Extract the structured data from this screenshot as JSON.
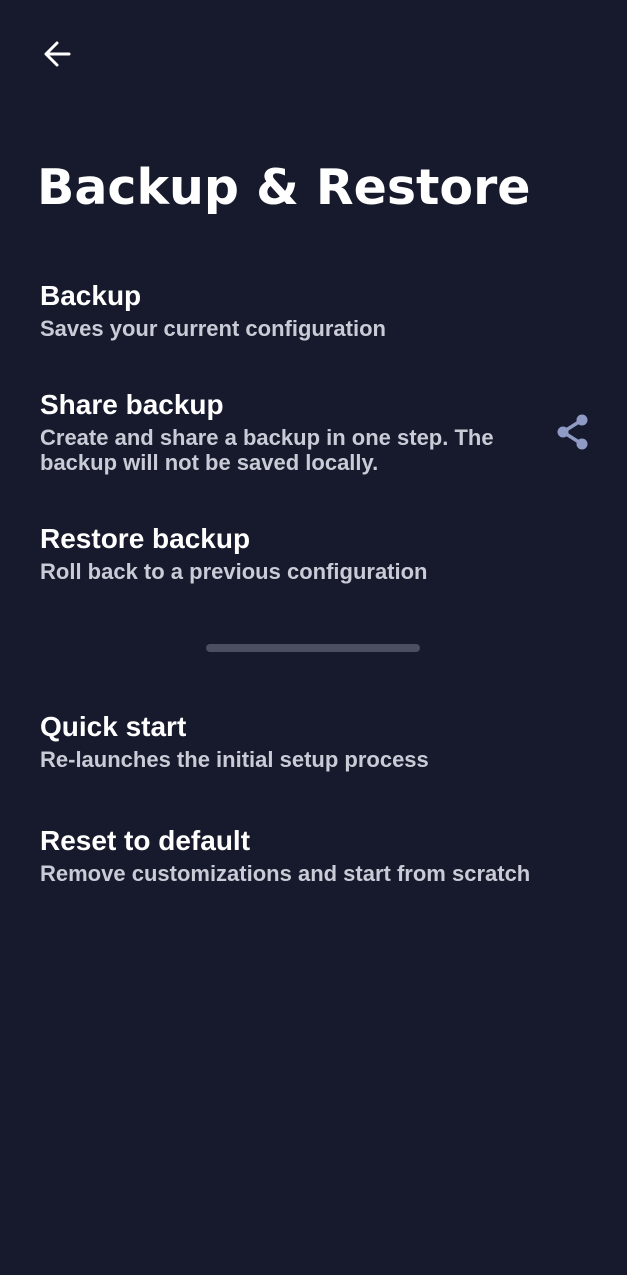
{
  "header": {
    "back_icon": "arrow-left-icon",
    "title": "Backup & Restore"
  },
  "items": [
    {
      "title": "Backup",
      "subtitle": "Saves your current configuration"
    },
    {
      "title": "Share backup",
      "subtitle": "Create and share a backup in one step. The backup will not be saved locally.",
      "icon": "share-icon"
    },
    {
      "title": "Restore backup",
      "subtitle": "Roll back to a previous configuration"
    },
    {
      "title": "Quick start",
      "subtitle": "Re-launches the initial setup process"
    },
    {
      "title": "Reset to default",
      "subtitle": "Remove customizations and start from scratch"
    }
  ],
  "colors": {
    "background": "#161a2c",
    "title_text": "#ffffff",
    "subtitle_text": "#c9cbd6",
    "share_icon": "#8f9bc4",
    "divider": "#4a4e60"
  }
}
